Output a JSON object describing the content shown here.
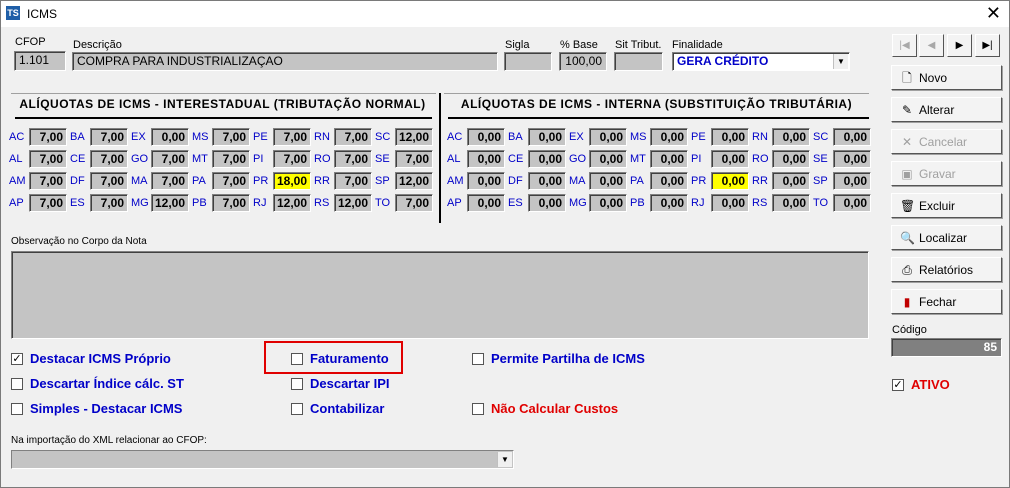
{
  "window": {
    "title": "ICMS",
    "app_icon": "TS"
  },
  "header": {
    "cfop_label": "CFOP",
    "cfop_value": "1.101",
    "descricao_label": "Descrição",
    "descricao_value": "COMPRA PARA INDUSTRIALIZAÇAO",
    "sigla_label": "Sigla",
    "sigla_value": "",
    "base_label": "% Base",
    "base_value": "100,00",
    "sit_label": "Sit Tribut.",
    "sit_value": "",
    "finalidade_label": "Finalidade",
    "finalidade_value": "GERA CRÉDITO"
  },
  "interestadual": {
    "title": "ALÍQUOTAS DE ICMS - INTERESTADUAL (TRIBUTAÇÃO NORMAL)",
    "rows": [
      [
        [
          "AC",
          "7,00"
        ],
        [
          "BA",
          "7,00"
        ],
        [
          "EX",
          "0,00"
        ],
        [
          "MS",
          "7,00"
        ],
        [
          "PE",
          "7,00"
        ],
        [
          "RN",
          "7,00"
        ],
        [
          "SC",
          "12,00"
        ]
      ],
      [
        [
          "AL",
          "7,00"
        ],
        [
          "CE",
          "7,00"
        ],
        [
          "GO",
          "7,00"
        ],
        [
          "MT",
          "7,00"
        ],
        [
          "PI",
          "7,00"
        ],
        [
          "RO",
          "7,00"
        ],
        [
          "SE",
          "7,00"
        ]
      ],
      [
        [
          "AM",
          "7,00"
        ],
        [
          "DF",
          "7,00"
        ],
        [
          "MA",
          "7,00"
        ],
        [
          "PA",
          "7,00"
        ],
        [
          "PR",
          "18,00"
        ],
        [
          "RR",
          "7,00"
        ],
        [
          "SP",
          "12,00"
        ]
      ],
      [
        [
          "AP",
          "7,00"
        ],
        [
          "ES",
          "7,00"
        ],
        [
          "MG",
          "12,00"
        ],
        [
          "PB",
          "7,00"
        ],
        [
          "RJ",
          "12,00"
        ],
        [
          "RS",
          "12,00"
        ],
        [
          "TO",
          "7,00"
        ]
      ]
    ]
  },
  "interna": {
    "title": "ALÍQUOTAS DE ICMS - INTERNA (SUBSTITUIÇÃO TRIBUTÁRIA)",
    "rows": [
      [
        [
          "AC",
          "0,00"
        ],
        [
          "BA",
          "0,00"
        ],
        [
          "EX",
          "0,00"
        ],
        [
          "MS",
          "0,00"
        ],
        [
          "PE",
          "0,00"
        ],
        [
          "RN",
          "0,00"
        ],
        [
          "SC",
          "0,00"
        ]
      ],
      [
        [
          "AL",
          "0,00"
        ],
        [
          "CE",
          "0,00"
        ],
        [
          "GO",
          "0,00"
        ],
        [
          "MT",
          "0,00"
        ],
        [
          "PI",
          "0,00"
        ],
        [
          "RO",
          "0,00"
        ],
        [
          "SE",
          "0,00"
        ]
      ],
      [
        [
          "AM",
          "0,00"
        ],
        [
          "DF",
          "0,00"
        ],
        [
          "MA",
          "0,00"
        ],
        [
          "PA",
          "0,00"
        ],
        [
          "PR",
          "0,00"
        ],
        [
          "RR",
          "0,00"
        ],
        [
          "SP",
          "0,00"
        ]
      ],
      [
        [
          "AP",
          "0,00"
        ],
        [
          "ES",
          "0,00"
        ],
        [
          "MG",
          "0,00"
        ],
        [
          "PB",
          "0,00"
        ],
        [
          "RJ",
          "0,00"
        ],
        [
          "RS",
          "0,00"
        ],
        [
          "TO",
          "0,00"
        ]
      ]
    ]
  },
  "highlight_state": "PR",
  "observacao_label": "Observação no Corpo da Nota",
  "checks": {
    "destacar_icms": {
      "label": "Destacar ICMS Próprio",
      "checked": true
    },
    "descartar_indice": {
      "label": "Descartar Índice cálc. ST",
      "checked": false
    },
    "simples": {
      "label": "Simples - Destacar ICMS",
      "checked": false
    },
    "faturamento": {
      "label": "Faturamento",
      "checked": false
    },
    "descartar_ipi": {
      "label": "Descartar IPI",
      "checked": false
    },
    "contabilizar": {
      "label": "Contabilizar",
      "checked": false
    },
    "partilha": {
      "label": "Permite Partilha de ICMS",
      "checked": false
    },
    "nao_calcular": {
      "label": "Não Calcular Custos",
      "checked": false
    }
  },
  "xml_label": "Na importação do XML relacionar ao CFOP:",
  "xml_value": "",
  "buttons": {
    "novo": "Novo",
    "alterar": "Alterar",
    "cancelar": "Cancelar",
    "gravar": "Gravar",
    "excluir": "Excluir",
    "localizar": "Localizar",
    "relatorios": "Relatórios",
    "fechar": "Fechar"
  },
  "nav": {
    "first": "|◀",
    "prev": "◀",
    "next": "▶",
    "last": "▶|"
  },
  "codigo_label": "Código",
  "codigo_value": "85",
  "ativo": {
    "label": "ATIVO",
    "checked": true
  },
  "colors": {
    "accent": "#0000c8",
    "highlight": "#ffff00",
    "red": "#e00000"
  }
}
